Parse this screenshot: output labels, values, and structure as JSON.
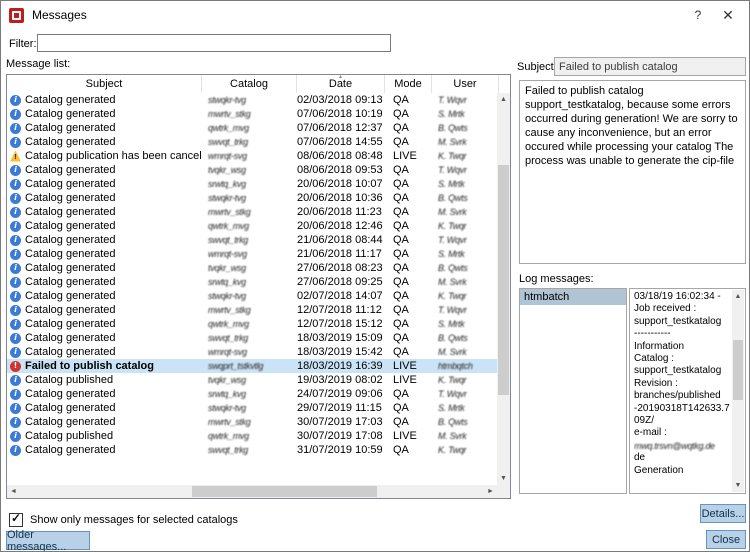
{
  "window": {
    "title": "Messages",
    "help_label": "?",
    "close_label": "✕"
  },
  "filter": {
    "label": "Filter:",
    "value": ""
  },
  "message_list": {
    "label": "Message list:",
    "columns": [
      "Subject",
      "Catalog",
      "Date",
      "Mode",
      "User"
    ],
    "sort_column": "Date",
    "rows": [
      {
        "icon": "info",
        "subject": "Catalog generated",
        "catalog": "stwqkr-tvg",
        "date": "02/03/2018 09:13",
        "mode": "QA",
        "user": "T. Wqvr"
      },
      {
        "icon": "info",
        "subject": "Catalog generated",
        "catalog": "mwrtv_stkg",
        "date": "07/06/2018 10:19",
        "mode": "QA",
        "user": "S. Mrtk"
      },
      {
        "icon": "info",
        "subject": "Catalog generated",
        "catalog": "qwtrk_mvg",
        "date": "07/06/2018 12:37",
        "mode": "QA",
        "user": "B. Qwts"
      },
      {
        "icon": "info",
        "subject": "Catalog generated",
        "catalog": "swvqt_trkg",
        "date": "07/06/2018 14:55",
        "mode": "QA",
        "user": "M. Svrk"
      },
      {
        "icon": "warning",
        "subject": "Catalog publication has been cancelled",
        "catalog": "wmrqt-svg",
        "date": "08/06/2018 08:48",
        "mode": "LIVE",
        "user": "K. Twqr"
      },
      {
        "icon": "info",
        "subject": "Catalog generated",
        "catalog": "tvqkr_wsg",
        "date": "08/06/2018 09:53",
        "mode": "QA",
        "user": "T. Wqvr"
      },
      {
        "icon": "info",
        "subject": "Catalog generated",
        "catalog": "srwtq_kvg",
        "date": "20/06/2018 10:07",
        "mode": "QA",
        "user": "S. Mrtk"
      },
      {
        "icon": "info",
        "subject": "Catalog generated",
        "catalog": "stwqkr-tvg",
        "date": "20/06/2018 10:36",
        "mode": "QA",
        "user": "B. Qwts"
      },
      {
        "icon": "info",
        "subject": "Catalog generated",
        "catalog": "mwrtv_stkg",
        "date": "20/06/2018 11:23",
        "mode": "QA",
        "user": "M. Svrk"
      },
      {
        "icon": "info",
        "subject": "Catalog generated",
        "catalog": "qwtrk_mvg",
        "date": "20/06/2018 12:46",
        "mode": "QA",
        "user": "K. Twqr"
      },
      {
        "icon": "info",
        "subject": "Catalog generated",
        "catalog": "swvqt_trkg",
        "date": "21/06/2018 08:44",
        "mode": "QA",
        "user": "T. Wqvr"
      },
      {
        "icon": "info",
        "subject": "Catalog generated",
        "catalog": "wmrqt-svg",
        "date": "21/06/2018 11:17",
        "mode": "QA",
        "user": "S. Mrtk"
      },
      {
        "icon": "info",
        "subject": "Catalog generated",
        "catalog": "tvqkr_wsg",
        "date": "27/06/2018 08:23",
        "mode": "QA",
        "user": "B. Qwts"
      },
      {
        "icon": "info",
        "subject": "Catalog generated",
        "catalog": "srwtq_kvg",
        "date": "27/06/2018 09:25",
        "mode": "QA",
        "user": "M. Svrk"
      },
      {
        "icon": "info",
        "subject": "Catalog generated",
        "catalog": "stwqkr-tvg",
        "date": "02/07/2018 14:07",
        "mode": "QA",
        "user": "K. Twqr"
      },
      {
        "icon": "info",
        "subject": "Catalog generated",
        "catalog": "mwrtv_stkg",
        "date": "12/07/2018 11:12",
        "mode": "QA",
        "user": "T. Wqvr"
      },
      {
        "icon": "info",
        "subject": "Catalog generated",
        "catalog": "qwtrk_mvg",
        "date": "12/07/2018 15:12",
        "mode": "QA",
        "user": "S. Mrtk"
      },
      {
        "icon": "info",
        "subject": "Catalog generated",
        "catalog": "swvqt_trkg",
        "date": "18/03/2019 15:09",
        "mode": "QA",
        "user": "B. Qwts"
      },
      {
        "icon": "info",
        "subject": "Catalog generated",
        "catalog": "wmrqt-svg",
        "date": "18/03/2019 15:42",
        "mode": "QA",
        "user": "M. Svrk"
      },
      {
        "icon": "error",
        "subject": "Failed to publish catalog",
        "catalog": "swqprt_tstkvtlg",
        "date": "18/03/2019 16:39",
        "mode": "LIVE",
        "user": "htmbqtch",
        "selected": true
      },
      {
        "icon": "info",
        "subject": "Catalog published",
        "catalog": "tvqkr_wsg",
        "date": "19/03/2019 08:02",
        "mode": "LIVE",
        "user": "K. Twqr"
      },
      {
        "icon": "info",
        "subject": "Catalog generated",
        "catalog": "srwtq_kvg",
        "date": "24/07/2019 09:06",
        "mode": "QA",
        "user": "T. Wqvr"
      },
      {
        "icon": "info",
        "subject": "Catalog generated",
        "catalog": "stwqkr-tvg",
        "date": "29/07/2019 11:15",
        "mode": "QA",
        "user": "S. Mrtk"
      },
      {
        "icon": "info",
        "subject": "Catalog generated",
        "catalog": "mwrtv_stkg",
        "date": "30/07/2019 17:03",
        "mode": "QA",
        "user": "B. Qwts"
      },
      {
        "icon": "info",
        "subject": "Catalog published",
        "catalog": "qwtrk_mvg",
        "date": "30/07/2019 17:08",
        "mode": "LIVE",
        "user": "M. Svrk"
      },
      {
        "icon": "info",
        "subject": "Catalog generated",
        "catalog": "swvqt_trkg",
        "date": "31/07/2019 10:59",
        "mode": "QA",
        "user": "K. Twqr"
      }
    ]
  },
  "footer": {
    "checkbox_label": "Show only messages for selected catalogs",
    "checked": true,
    "older_button": "Older messages..."
  },
  "detail": {
    "subject_label": "Subject:",
    "subject_value": "Failed to publish catalog",
    "message": "Failed to publish catalog support_testkatalog, because some errors occurred during generation! We are sorry to cause any inconvenience, but an error occured while processing your catalog The process was unable to generate the cip-file",
    "log_label": "Log messages:",
    "log_sources": [
      "htmbatch"
    ],
    "log_lines": [
      {
        "t": "03/18/19 16:02:34 -"
      },
      {
        "t": "Job received :"
      },
      {
        "t": "support_testkatalog"
      },
      {
        "t": "-----------"
      },
      {
        "t": "Information"
      },
      {
        "t": "Catalog :"
      },
      {
        "t": "support_testkatalog"
      },
      {
        "t": "Revision :"
      },
      {
        "t": "branches/published"
      },
      {
        "t": "-20190318T142633.7"
      },
      {
        "t": "09Z/"
      },
      {
        "t": "e-mail :"
      },
      {
        "t": "mwq.trsvn@wqtkg.de",
        "s": true
      },
      {
        "t": "de"
      },
      {
        "t": "Generation"
      }
    ]
  },
  "buttons": {
    "details": "Details...",
    "close": "Close"
  }
}
